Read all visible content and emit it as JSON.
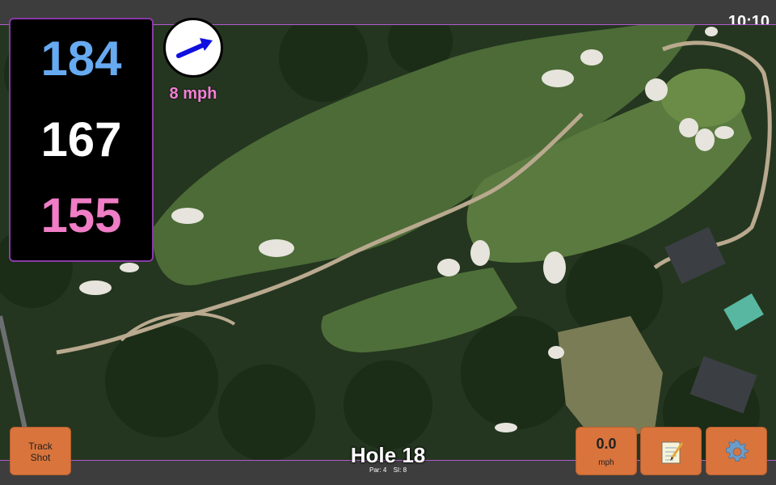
{
  "status": {
    "clock": "10:10"
  },
  "distances": {
    "back": "184",
    "middle": "167",
    "front": "155"
  },
  "wind": {
    "speed": "8 mph",
    "direction_icon": "wind-arrow-icon"
  },
  "hole": {
    "title": "Hole 18",
    "par": "Par: 4",
    "si": "SI: 8"
  },
  "buttons": {
    "track_shot": "Track\nShot",
    "speed_value": "0.0",
    "speed_unit": "mph",
    "notes_icon": "notepad-icon",
    "settings_icon": "gear-icon"
  },
  "colors": {
    "back": "#66aaf2",
    "middle": "#ffffff",
    "front": "#f07dc6",
    "wind_text": "#f47fd6",
    "button": "#d9743c",
    "accent_border": "#b25bd0"
  }
}
